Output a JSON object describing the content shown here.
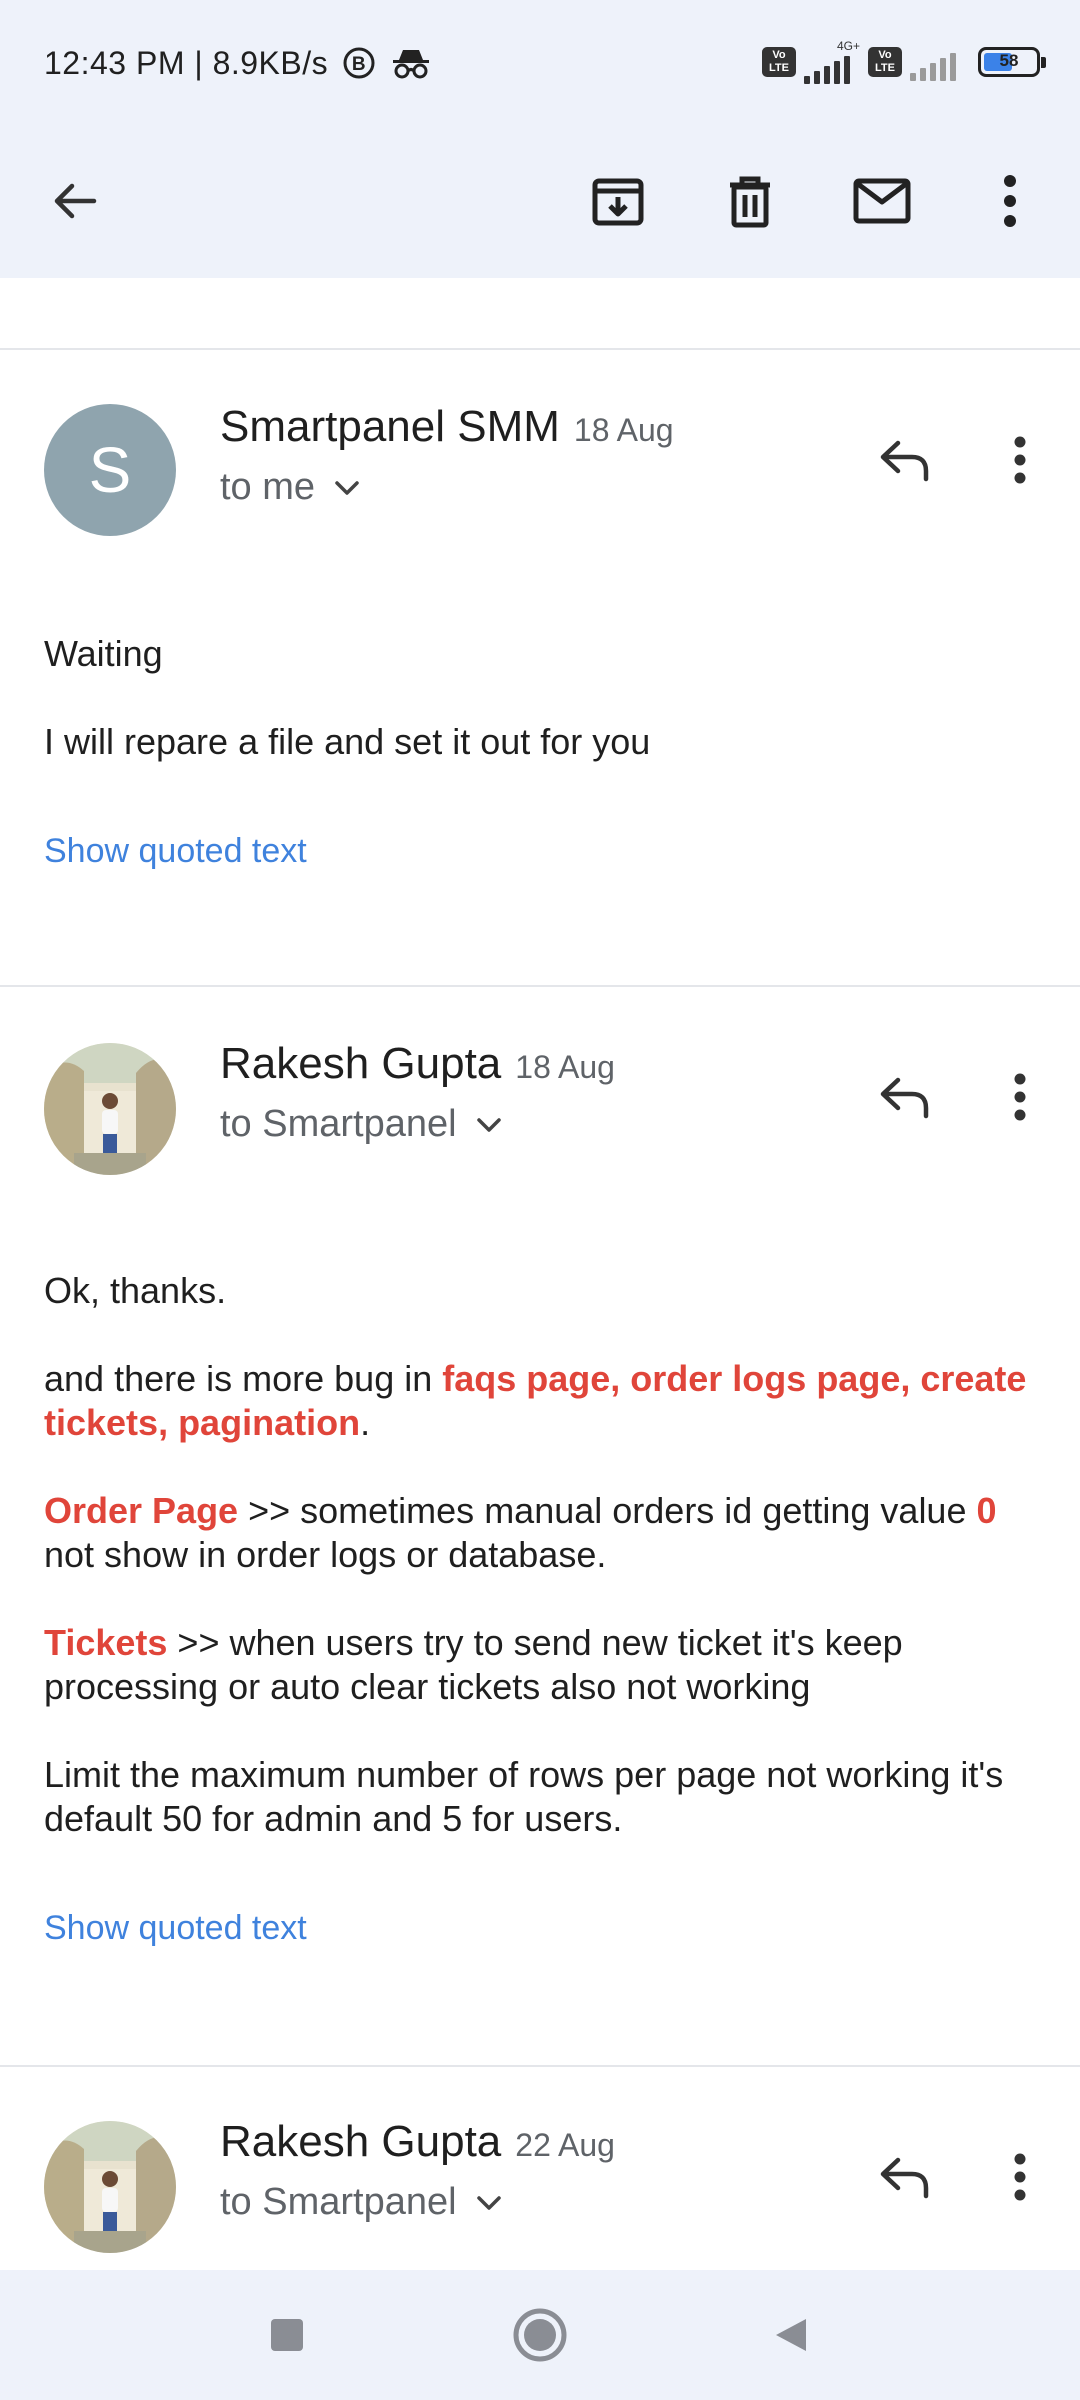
{
  "status_bar": {
    "time_speed": "12:43 PM | 8.9KB/s",
    "network_label": "4G+",
    "volte_label": "Vo LTE",
    "battery_level": "58"
  },
  "toolbar": {
    "icons": [
      "back-arrow-icon",
      "archive-icon",
      "delete-icon",
      "mark-unread-icon",
      "more-vert-icon"
    ]
  },
  "messages": [
    {
      "avatar_letter": "S",
      "sender": "Smartpanel SMM",
      "date": "18 Aug",
      "recipient": "to me",
      "lines": [
        "Waiting",
        "I will repare a file and set it out for you"
      ],
      "quoted_link": "Show quoted text"
    },
    {
      "sender": "Rakesh Gupta",
      "date": "18 Aug",
      "recipient": "to Smartpanel",
      "line1": "Ok, thanks.",
      "p2_pre": "and there is more bug in ",
      "p2_hl": "faqs page, order logs page, create tickets, pagination",
      "p2_post": ".",
      "p3_hl": "Order Page",
      "p3_mid": " >> sometimes manual orders id getting value ",
      "p3_hl2": "0",
      "p3_post": " not show in order logs or database.",
      "p4_hl": "Tickets",
      "p4_post": " >> when users try to send new ticket it's keep processing or auto clear tickets also not working",
      "p5": "Limit the maximum number of rows per page not working it's default 50 for admin and 5 for users.",
      "quoted_link": "Show quoted text"
    },
    {
      "sender": "Rakesh Gupta",
      "date": "22 Aug",
      "recipient": "to Smartpanel"
    }
  ],
  "nav_bar": {
    "icons": [
      "recents-square-icon",
      "home-circle-icon",
      "back-triangle-icon"
    ]
  },
  "colors": {
    "highlight": "#e0453a",
    "link": "#3f82dd",
    "header_bg": "#eef2fa",
    "avatar_letter_bg": "#8fa4ae"
  }
}
